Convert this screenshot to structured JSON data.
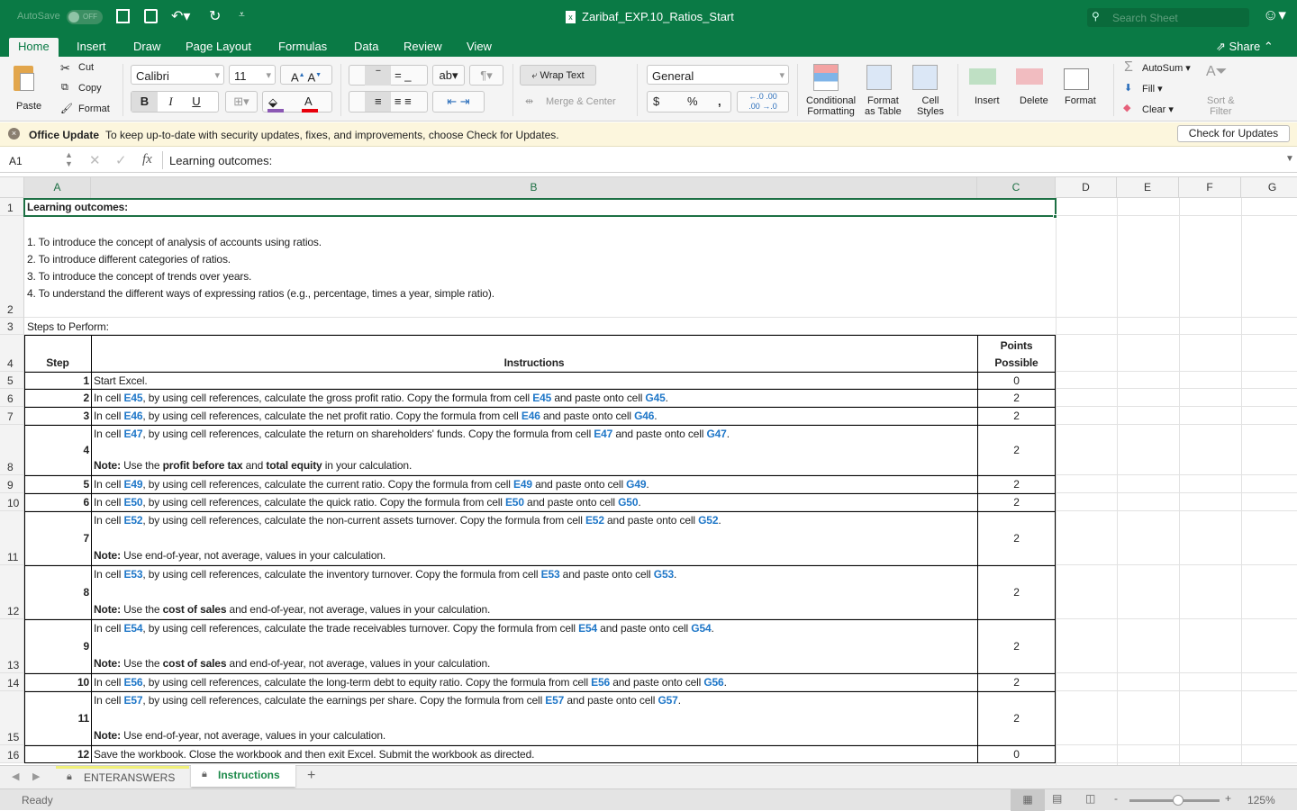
{
  "titlebar": {
    "autosave_label": "AutoSave",
    "autosave_state": "OFF",
    "file_title": "Zaribaf_EXP.10_Ratios_Start",
    "search_placeholder": "Search Sheet"
  },
  "ribbon_tabs": [
    "Home",
    "Insert",
    "Draw",
    "Page Layout",
    "Formulas",
    "Data",
    "Review",
    "View"
  ],
  "active_tab": "Home",
  "share_label": "Share",
  "ribbon": {
    "paste": "Paste",
    "cut": "Cut",
    "copy": "Copy",
    "format_painter": "Format",
    "font_name": "Calibri",
    "font_size": "11",
    "bold": "B",
    "italic": "I",
    "underline": "U",
    "wrap_text": "Wrap Text",
    "merge_center": "Merge & Center",
    "number_format": "General",
    "currency": "$",
    "percent": "%",
    "comma": ",",
    "conditional_formatting": [
      "Conditional",
      "Formatting"
    ],
    "format_as_table": [
      "Format",
      "as Table"
    ],
    "cell_styles": [
      "Cell",
      "Styles"
    ],
    "insert": "Insert",
    "delete": "Delete",
    "format": "Format",
    "autosum": "AutoSum",
    "fill": "Fill",
    "clear": "Clear",
    "sort_filter": [
      "Sort &",
      "Filter"
    ]
  },
  "message_bar": {
    "title": "Office Update",
    "text": "To keep up-to-date with security updates, fixes, and improvements, choose Check for Updates.",
    "button": "Check for Updates"
  },
  "formula_bar": {
    "name_box": "A1",
    "fx": "fx",
    "content": "Learning outcomes:"
  },
  "columns": [
    "A",
    "B",
    "C",
    "D",
    "E",
    "F",
    "G"
  ],
  "rows": [
    "1",
    "2",
    "3",
    "4",
    "5",
    "6",
    "7",
    "8",
    "9",
    "10",
    "11",
    "12",
    "13",
    "14",
    "15",
    "16"
  ],
  "sheet": {
    "a1": "Learning outcomes:",
    "outcomes": [
      "1. To introduce the concept of analysis of accounts using ratios.",
      "2. To introduce different categories of ratios.",
      "3. To introduce the concept of trends over years.",
      "4. To understand the different ways of expressing ratios (e.g., percentage, times a year, simple ratio)."
    ],
    "a3": "Steps to Perform:",
    "header_step": "Step",
    "header_instructions": "Instructions",
    "header_points": [
      "Points",
      "Possible"
    ],
    "steps": [
      {
        "step": "1",
        "points": "0",
        "line1": [
          {
            "t": "Start Excel."
          }
        ]
      },
      {
        "step": "2",
        "points": "2",
        "line1": [
          {
            "t": "In cell "
          },
          {
            "t": "E45",
            "s": "ref"
          },
          {
            "t": ", by using cell references, calculate the gross profit ratio. Copy the formula from cell "
          },
          {
            "t": "E45",
            "s": "ref"
          },
          {
            "t": " and paste onto cell "
          },
          {
            "t": "G45",
            "s": "ref"
          },
          {
            "t": "."
          }
        ]
      },
      {
        "step": "3",
        "points": "2",
        "line1": [
          {
            "t": "In cell "
          },
          {
            "t": "E46",
            "s": "ref"
          },
          {
            "t": ", by using cell references, calculate the net profit ratio. Copy the formula from cell "
          },
          {
            "t": "E46",
            "s": "ref"
          },
          {
            "t": " and paste onto cell "
          },
          {
            "t": "G46",
            "s": "ref"
          },
          {
            "t": "."
          }
        ]
      },
      {
        "step": "4",
        "points": "2",
        "line1": [
          {
            "t": "In cell "
          },
          {
            "t": "E47",
            "s": "ref"
          },
          {
            "t": ", by using cell references, calculate the return on shareholders' funds. Copy the formula from cell "
          },
          {
            "t": "E47",
            "s": "ref"
          },
          {
            "t": " and paste onto cell "
          },
          {
            "t": "G47",
            "s": "ref"
          },
          {
            "t": "."
          }
        ],
        "note": [
          {
            "t": "Note:",
            "s": "b"
          },
          {
            "t": " Use the "
          },
          {
            "t": "profit before tax",
            "s": "b"
          },
          {
            "t": " and "
          },
          {
            "t": "total equity",
            "s": "b"
          },
          {
            "t": " in your calculation."
          }
        ]
      },
      {
        "step": "5",
        "points": "2",
        "line1": [
          {
            "t": "In cell "
          },
          {
            "t": "E49",
            "s": "ref"
          },
          {
            "t": ", by using cell references, calculate the current ratio. Copy the formula from cell "
          },
          {
            "t": "E49",
            "s": "ref"
          },
          {
            "t": " and paste onto cell "
          },
          {
            "t": "G49",
            "s": "ref"
          },
          {
            "t": "."
          }
        ]
      },
      {
        "step": "6",
        "points": "2",
        "line1": [
          {
            "t": "In cell "
          },
          {
            "t": "E50",
            "s": "ref"
          },
          {
            "t": ", by using cell references, calculate the quick ratio. Copy the formula from cell "
          },
          {
            "t": "E50",
            "s": "ref"
          },
          {
            "t": " and paste onto cell "
          },
          {
            "t": "G50",
            "s": "ref"
          },
          {
            "t": "."
          }
        ]
      },
      {
        "step": "7",
        "points": "2",
        "line1": [
          {
            "t": "In cell "
          },
          {
            "t": "E52",
            "s": "ref"
          },
          {
            "t": ", by using cell references, calculate the non-current assets turnover. Copy the formula from cell "
          },
          {
            "t": "E52",
            "s": "ref"
          },
          {
            "t": " and paste onto cell "
          },
          {
            "t": "G52",
            "s": "ref"
          },
          {
            "t": "."
          }
        ],
        "note": [
          {
            "t": "Note:",
            "s": "b"
          },
          {
            "t": " Use end-of-year, not average, values in your calculation."
          }
        ]
      },
      {
        "step": "8",
        "points": "2",
        "line1": [
          {
            "t": "In cell "
          },
          {
            "t": "E53",
            "s": "ref"
          },
          {
            "t": ", by using cell references, calculate the inventory turnover. Copy the formula from cell "
          },
          {
            "t": "E53",
            "s": "ref"
          },
          {
            "t": " and paste onto cell "
          },
          {
            "t": "G53",
            "s": "ref"
          },
          {
            "t": "."
          }
        ],
        "note": [
          {
            "t": "Note:",
            "s": "b"
          },
          {
            "t": " Use the "
          },
          {
            "t": "cost of sales",
            "s": "b"
          },
          {
            "t": " and end-of-year, not average, values in your calculation."
          }
        ]
      },
      {
        "step": "9",
        "points": "2",
        "line1": [
          {
            "t": "In cell "
          },
          {
            "t": "E54",
            "s": "ref"
          },
          {
            "t": ", by using cell references, calculate the trade receivables turnover. Copy the formula from cell "
          },
          {
            "t": "E54",
            "s": "ref"
          },
          {
            "t": " and paste onto cell "
          },
          {
            "t": "G54",
            "s": "ref"
          },
          {
            "t": "."
          }
        ],
        "note": [
          {
            "t": "Note:",
            "s": "b"
          },
          {
            "t": " Use the "
          },
          {
            "t": "cost of sales",
            "s": "b"
          },
          {
            "t": " and end-of-year, not average, values in your calculation."
          }
        ]
      },
      {
        "step": "10",
        "points": "2",
        "line1": [
          {
            "t": "In cell "
          },
          {
            "t": "E56",
            "s": "ref"
          },
          {
            "t": ", by using cell references, calculate the long-term debt to equity ratio. Copy the formula from cell "
          },
          {
            "t": "E56",
            "s": "ref"
          },
          {
            "t": " and paste onto cell "
          },
          {
            "t": "G56",
            "s": "ref"
          },
          {
            "t": "."
          }
        ]
      },
      {
        "step": "11",
        "points": "2",
        "line1": [
          {
            "t": "In cell "
          },
          {
            "t": "E57",
            "s": "ref"
          },
          {
            "t": ", by using cell references, calculate the earnings per share. Copy the formula from cell "
          },
          {
            "t": "E57",
            "s": "ref"
          },
          {
            "t": " and paste onto cell "
          },
          {
            "t": "G57",
            "s": "ref"
          },
          {
            "t": "."
          }
        ],
        "note": [
          {
            "t": "Note:",
            "s": "b"
          },
          {
            "t": " Use end-of-year, not average, values in your calculation."
          }
        ]
      },
      {
        "step": "12",
        "points": "0",
        "line1": [
          {
            "t": "Save the workbook. Close the workbook and then exit Excel. Submit the workbook as directed."
          }
        ]
      }
    ]
  },
  "sheet_tabs": [
    "ENTERANSWERS",
    "Instructions"
  ],
  "active_sheet": "Instructions",
  "status": {
    "ready": "Ready",
    "zoom": "125%",
    "zoom_percent": 125
  },
  "colors": {
    "brand": "#0a7a45",
    "ref": "#1f77c8",
    "selection": "#1d7044"
  }
}
